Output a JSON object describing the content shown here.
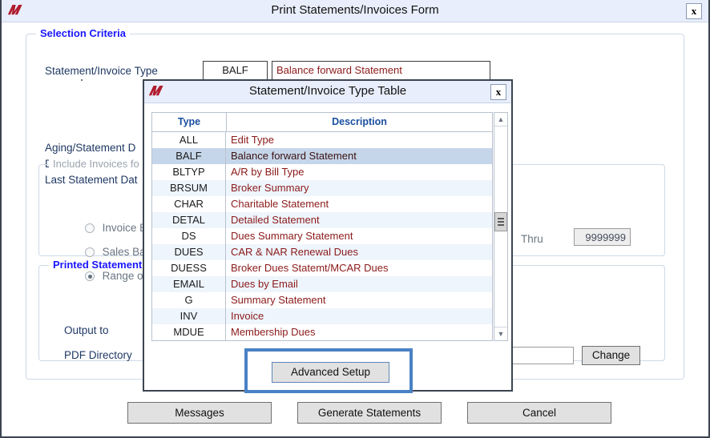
{
  "window": {
    "title": "Print Statements/Invoices Form",
    "logo_icon": "app-logo-icon",
    "close_label": "x"
  },
  "selection_criteria": {
    "legend": "Selection Criteria",
    "statement_type": {
      "label": "Statement/Invoice Type",
      "code_value": "BALF",
      "description_value": "Balance forward Statement"
    },
    "date_labels": {
      "aging_statement_date": "Aging/Statement D",
      "due_date": "Due Date",
      "last_statement_date": "Last Statement Dat"
    },
    "include_invoices": {
      "legend": "Include Invoices fo",
      "options": [
        {
          "label": "Invoice B",
          "selected": false
        },
        {
          "label": "Sales Bat",
          "selected": false
        },
        {
          "label": "Range of",
          "selected": true
        }
      ],
      "thru_label": "Thru",
      "thru_value": "9999999"
    },
    "printed_statements": {
      "legend": "Printed Statement",
      "output_to_label": "Output to",
      "pdf_directory_label": "PDF Directory",
      "pdf_directory_value": "",
      "change_label": "Change"
    }
  },
  "footer_buttons": {
    "messages": "Messages",
    "generate": "Generate Statements",
    "cancel": "Cancel"
  },
  "type_table_dialog": {
    "title": "Statement/Invoice Type Table",
    "logo_icon": "app-logo-icon",
    "close_label": "x",
    "columns": [
      "Type",
      "Description"
    ],
    "rows": [
      {
        "type": "ALL",
        "description": "Edit Type",
        "selected": false
      },
      {
        "type": "BALF",
        "description": "Balance forward Statement",
        "selected": true
      },
      {
        "type": "BLTYP",
        "description": "A/R by Bill Type",
        "selected": false
      },
      {
        "type": "BRSUM",
        "description": "Broker Summary",
        "selected": false
      },
      {
        "type": "CHAR",
        "description": "Charitable Statement",
        "selected": false
      },
      {
        "type": "DETAL",
        "description": "Detailed Statement",
        "selected": false
      },
      {
        "type": "DS",
        "description": "Dues Summary Statement",
        "selected": false
      },
      {
        "type": "DUES",
        "description": "CAR & NAR Renewal Dues",
        "selected": false
      },
      {
        "type": "DUESS",
        "description": "Broker Dues Statemt/MCAR Dues",
        "selected": false
      },
      {
        "type": "EMAIL",
        "description": "Dues by Email",
        "selected": false
      },
      {
        "type": "G",
        "description": "Summary Statement",
        "selected": false
      },
      {
        "type": "INV",
        "description": "Invoice",
        "selected": false
      },
      {
        "type": "MDUE",
        "description": "Membership Dues",
        "selected": false
      }
    ],
    "scrollbar": {
      "up_icon": "chevron-up-icon",
      "down_icon": "chevron-down-icon",
      "thumb_icon": "scrollbar-thumb-grip"
    },
    "advanced_setup_label": "Advanced Setup"
  },
  "colors": {
    "titlebar": "#e8eefb",
    "legend_blue": "#1a16ff",
    "label_blue": "#1f3864",
    "description_red": "#8b1a1a",
    "selected_row": "#c6d6ea",
    "alt_row": "#eef5fd",
    "focus_border": "#4a81c4",
    "logo_red": "#b01c2e"
  }
}
